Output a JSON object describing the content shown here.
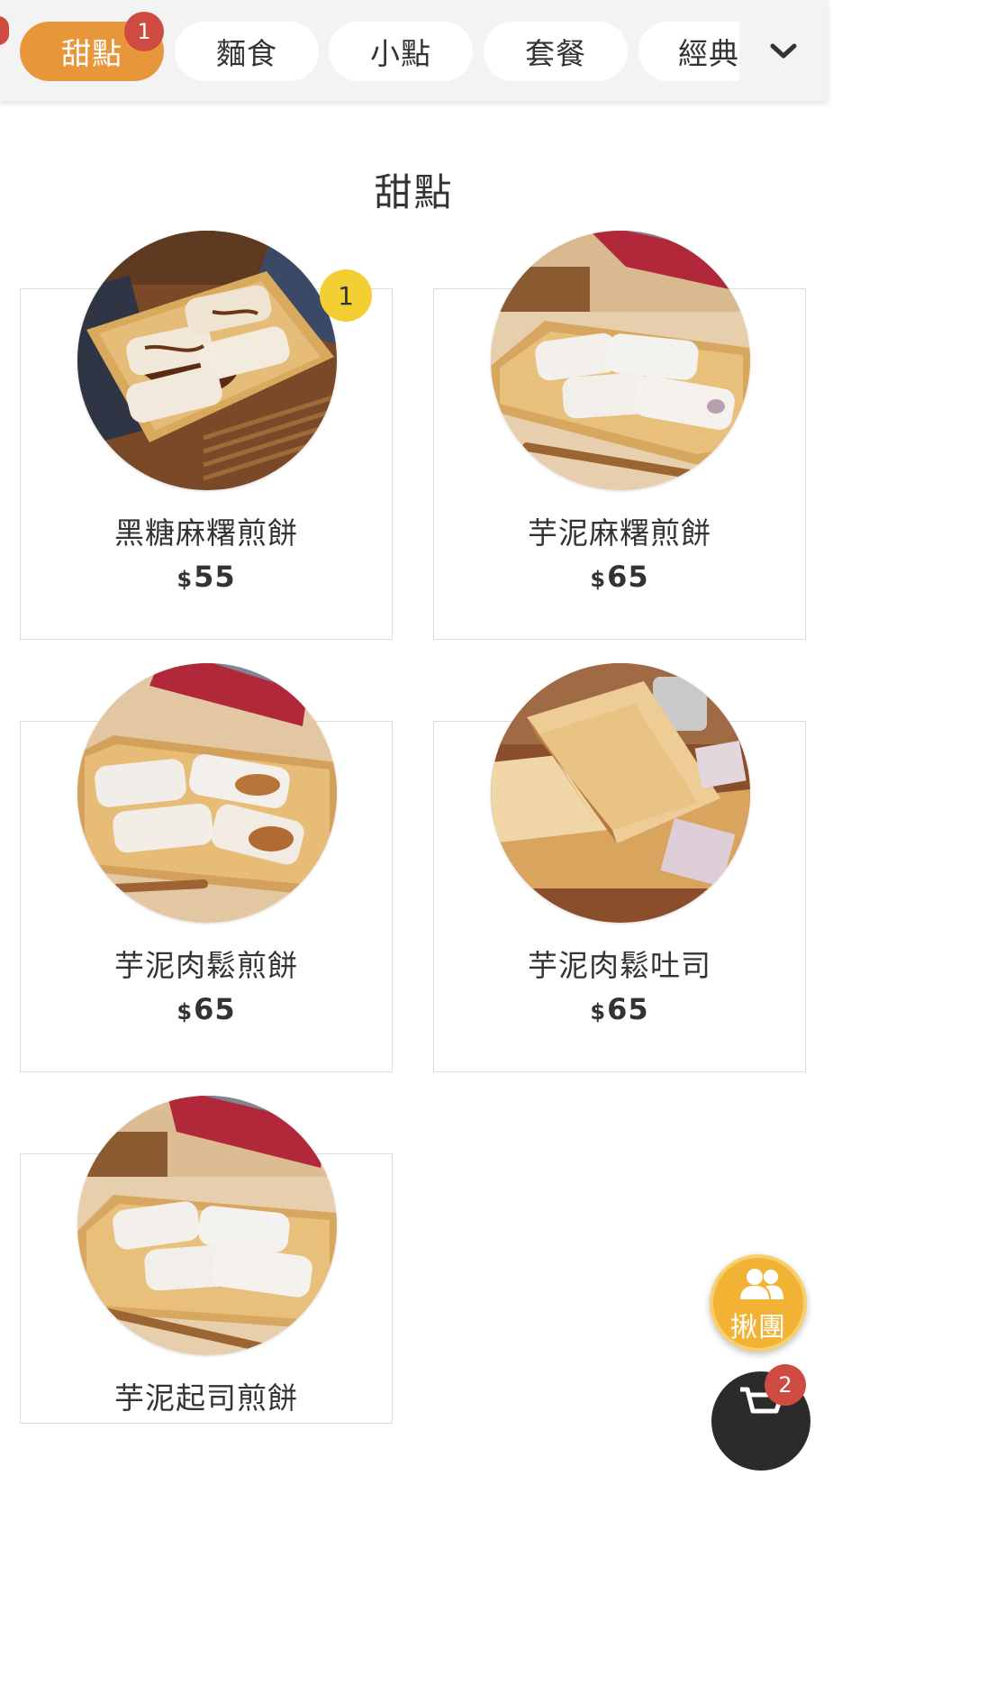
{
  "categories": {
    "items": [
      {
        "label": "甜點",
        "active": true,
        "badge": "1"
      },
      {
        "label": "麵食"
      },
      {
        "label": "小點"
      },
      {
        "label": "套餐"
      },
      {
        "label": "經典"
      }
    ],
    "expand_icon": "chevron-down-icon"
  },
  "section": {
    "title": "甜點"
  },
  "products": [
    {
      "name": "黑糖麻糬煎餅",
      "currency": "$",
      "price": "55",
      "cart_qty": "1"
    },
    {
      "name": "芋泥麻糬煎餅",
      "currency": "$",
      "price": "65"
    },
    {
      "name": "芋泥肉鬆煎餅",
      "currency": "$",
      "price": "65"
    },
    {
      "name": "芋泥肉鬆吐司",
      "currency": "$",
      "price": "65"
    },
    {
      "name": "芋泥起司煎餅",
      "currency": "$",
      "price": ""
    }
  ],
  "group_order": {
    "label": "揪團",
    "icon": "group-icon"
  },
  "cart": {
    "count": "2",
    "icon": "cart-icon"
  },
  "colors": {
    "accent": "#e8963a",
    "badge_red": "#cf4b42",
    "qty_yellow": "#f4cf33",
    "fab_yellow": "#f2b233"
  }
}
